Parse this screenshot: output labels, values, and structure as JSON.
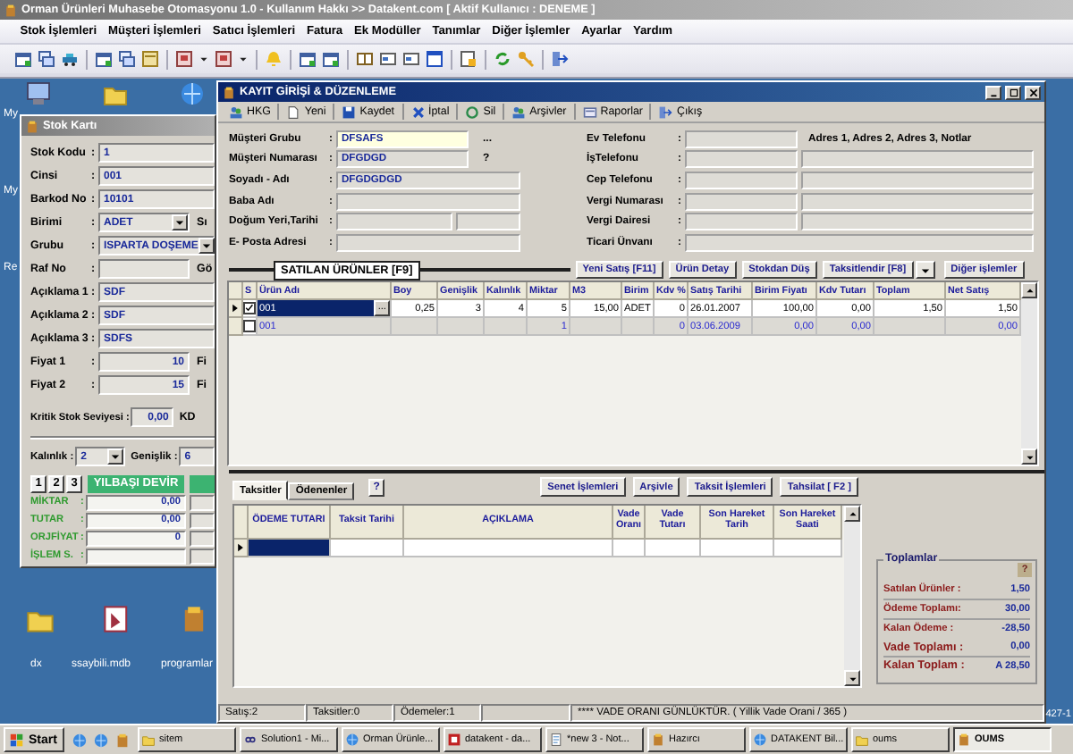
{
  "app": {
    "title": "Orman Ürünleri Muhasebe Otomasyonu 1.0 -  Kullanım Hakkı >> Datakent.com [ Aktif Kullanıcı : DENEME ]",
    "menu": [
      "Stok İşlemleri",
      "Müşteri İşlemleri",
      "Satıcı İşlemleri",
      "Fatura",
      "Ek Modüller",
      "Tanımlar",
      "Diğer İşlemler",
      "Ayarlar",
      "Yardım"
    ]
  },
  "desktop": {
    "top_labels": [
      "My",
      "My",
      "Re"
    ],
    "bottom_icons": [
      {
        "label": "dx",
        "kind": "folder"
      },
      {
        "label": "ssaybili.mdb",
        "kind": "database"
      },
      {
        "label": "programlar",
        "kind": "app"
      }
    ],
    "corner_text": "427-1"
  },
  "stock_card": {
    "title": "Stok Kartı",
    "fields": [
      {
        "label": "Stok Kodu",
        "sep": ":",
        "value": "1",
        "kind": "text"
      },
      {
        "label": "Cinsi",
        "sep": ":",
        "value": "001",
        "kind": "text"
      },
      {
        "label": "Barkod No",
        "sep": ":",
        "value": "10101",
        "kind": "text"
      },
      {
        "label": "Birimi",
        "sep": ":",
        "value": "ADET",
        "kind": "dropdown",
        "side": "Sı"
      },
      {
        "label": "Grubu",
        "sep": ":",
        "value": "ISPARTA DOŞEME",
        "kind": "dropdown"
      },
      {
        "label": "Raf No",
        "sep": ":",
        "kind": "text",
        "side": "Gö"
      },
      {
        "label": "Açıklama 1",
        "sep": ":",
        "value": "SDF",
        "kind": "text"
      },
      {
        "label": "Açıklama 2",
        "sep": ":",
        "value": "SDF",
        "kind": "text"
      },
      {
        "label": "Açıklama 3",
        "sep": ":",
        "value": "SDFS",
        "kind": "text"
      },
      {
        "label": "Fiyat 1",
        "sep": ":",
        "value": "10",
        "kind": "money",
        "side": "Fi"
      },
      {
        "label": "Fiyat 2",
        "sep": ":",
        "value": "15",
        "kind": "money",
        "side": "Fi"
      }
    ],
    "critical": {
      "label": "Kritik Stok Seviyesi :",
      "value": "0,00",
      "side": "KD"
    },
    "thickness": {
      "label": "Kalınlık :",
      "value": "2",
      "width_label": "Genişlik :",
      "width_value": "6"
    },
    "pages": [
      "1",
      "2",
      "3"
    ],
    "devir": {
      "title": "YILBAŞI DEVİR",
      "rows": [
        {
          "label": "MİKTAR",
          "sep": ":",
          "value": "0,00"
        },
        {
          "label": "TUTAR",
          "sep": ":",
          "value": "0,00"
        },
        {
          "label": "ORJFİYAT",
          "sep": ":",
          "value": "0"
        },
        {
          "label": "İŞLEM S.",
          "sep": ":"
        }
      ]
    }
  },
  "entry": {
    "title": "KAYIT GİRİŞİ & DÜZENLEME",
    "toolbar": [
      {
        "label": "HKG",
        "kind": "users"
      },
      {
        "label": "Yeni",
        "kind": "page"
      },
      {
        "label": "Kaydet",
        "kind": "save"
      },
      {
        "label": "İptal",
        "kind": "cross"
      },
      {
        "label": "Sil",
        "kind": "recycle"
      },
      {
        "label": "Arşivler",
        "kind": "users"
      },
      {
        "label": "Raporlar",
        "kind": "report"
      },
      {
        "label": "Çıkış",
        "kind": "exit"
      }
    ],
    "left_fields": [
      {
        "label": "Müşteri Grubu",
        "sep": ":",
        "value": "DFSAFS",
        "kind": "lookup",
        "suffix": "..."
      },
      {
        "label": "Müşteri Numarası",
        "sep": ":",
        "value": "DFGDGD",
        "kind": "short",
        "suffix": "?"
      },
      {
        "label": "Soyadı - Adı",
        "sep": ":",
        "value": "DFGDGDGD",
        "kind": "long"
      },
      {
        "label": "Baba Adı",
        "sep": ":",
        "kind": "long"
      },
      {
        "label": "Doğum Yeri,Tarihi",
        "sep": ":",
        "kind": "double"
      },
      {
        "label": "E- Posta Adresi",
        "sep": ":",
        "kind": "long"
      }
    ],
    "right_fields": [
      {
        "label": "Ev Telefonu",
        "sep": ":",
        "kind": "note",
        "note": "Adres 1, Adres 2, Adres 3, Notlar"
      },
      {
        "label": "İşTelefonu",
        "sep": ":",
        "kind": "pair"
      },
      {
        "label": "Cep Telefonu",
        "sep": ":",
        "kind": "pair"
      },
      {
        "label": "Vergi Numarası",
        "sep": ":",
        "kind": "pair"
      },
      {
        "label": "Vergi Dairesi",
        "sep": ":",
        "kind": "pair"
      },
      {
        "label": "Ticari Ünvanı",
        "sep": ":",
        "kind": "single"
      }
    ],
    "section_title": "SATILAN ÜRÜNLER [F9]",
    "actions": [
      {
        "label": "Yeni Satış [F11]",
        "kind": "button"
      },
      {
        "label": "Ürün Detay",
        "kind": "button"
      },
      {
        "label": "Stokdan Düş",
        "kind": "button"
      },
      {
        "label": "Taksitlendir [F8]",
        "kind": "button"
      },
      {
        "kind": "caret"
      },
      {
        "label": "Diğer işlemler",
        "kind": "button"
      }
    ],
    "products": {
      "columns": [
        "S",
        "Ürün Adı",
        "Boy",
        "Genişlik",
        "Kalınlık",
        "Miktar",
        "M3",
        "Birim",
        "Kdv %",
        "Satış Tarihi",
        "Birim Fiyatı",
        "Kdv Tutarı",
        "Toplam",
        "Net Satış"
      ],
      "rows": [
        {
          "selected": true,
          "checked": true,
          "editor_button": "...",
          "cells": [
            "",
            "001",
            "0,25",
            "3",
            "4",
            "5",
            "15,00",
            "ADET",
            "0",
            "26.01.2007",
            "100,00",
            "0,00",
            "1,50",
            "1,50"
          ]
        },
        {
          "selected": false,
          "checked": false,
          "cells": [
            "",
            "001",
            "",
            "",
            "",
            "1",
            "",
            "",
            "0",
            "03.06.2009",
            "0,00",
            "0,00",
            "",
            "0,00"
          ]
        }
      ]
    },
    "tabs": [
      {
        "label": "Taksitler",
        "selected": true
      },
      {
        "label": "Ödenenler",
        "selected": false
      }
    ],
    "tabs_help": "?",
    "buttons": [
      "Senet İşlemleri",
      "Arşivle",
      "Taksit İşlemleri",
      "Tahsilat [ F2 ]"
    ],
    "installments": {
      "columns": [
        "ÖDEME TUTARI",
        "Taksit Tarihi",
        "AÇIKLAMA",
        "Vade Oranı",
        "Vade Tutarı",
        "Son Hareket Tarih",
        "Son Hareket Saati"
      ]
    },
    "totals": {
      "title": "Toplamlar",
      "help": "?",
      "rows": [
        {
          "label": "Satılan Ürünler :",
          "value": "1,50",
          "kind": "normal"
        },
        {
          "label": "Ödeme Toplamı:",
          "value": "30,00",
          "kind": "normal"
        },
        {
          "label": "Kalan Ödeme :",
          "value": "-28,50",
          "kind": "normal"
        },
        {
          "label": "Vade Toplamı :",
          "value": "0,00",
          "kind": "large"
        },
        {
          "label": "Kalan Toplam :",
          "value": "A 28,50",
          "kind": "large"
        }
      ]
    },
    "status_bar": [
      "Satış:2",
      "Taksitler:0",
      "Ödemeler:1",
      "**** VADE ORANI GÜNLÜKTÜR. ( Yillik Vade Orani / 365 )"
    ]
  },
  "taskbar": {
    "start": "Start",
    "tasks": [
      {
        "label": "sitem",
        "kind": "folder",
        "selected": false
      },
      {
        "label": "Solution1 - Mi...",
        "kind": "loop",
        "selected": false
      },
      {
        "label": "Orman Ürünle...",
        "kind": "globe",
        "selected": false
      },
      {
        "label": "datakent - da...",
        "kind": "ftp",
        "selected": false
      },
      {
        "label": "*new  3 - Not...",
        "kind": "notepad",
        "selected": false
      },
      {
        "label": "Hazırcı",
        "kind": "app",
        "selected": false
      },
      {
        "label": "DATAKENT Bil...",
        "kind": "globe",
        "selected": false
      },
      {
        "label": "oums",
        "kind": "folder",
        "selected": false
      },
      {
        "label": "OUMS",
        "kind": "app",
        "selected": true
      }
    ]
  }
}
